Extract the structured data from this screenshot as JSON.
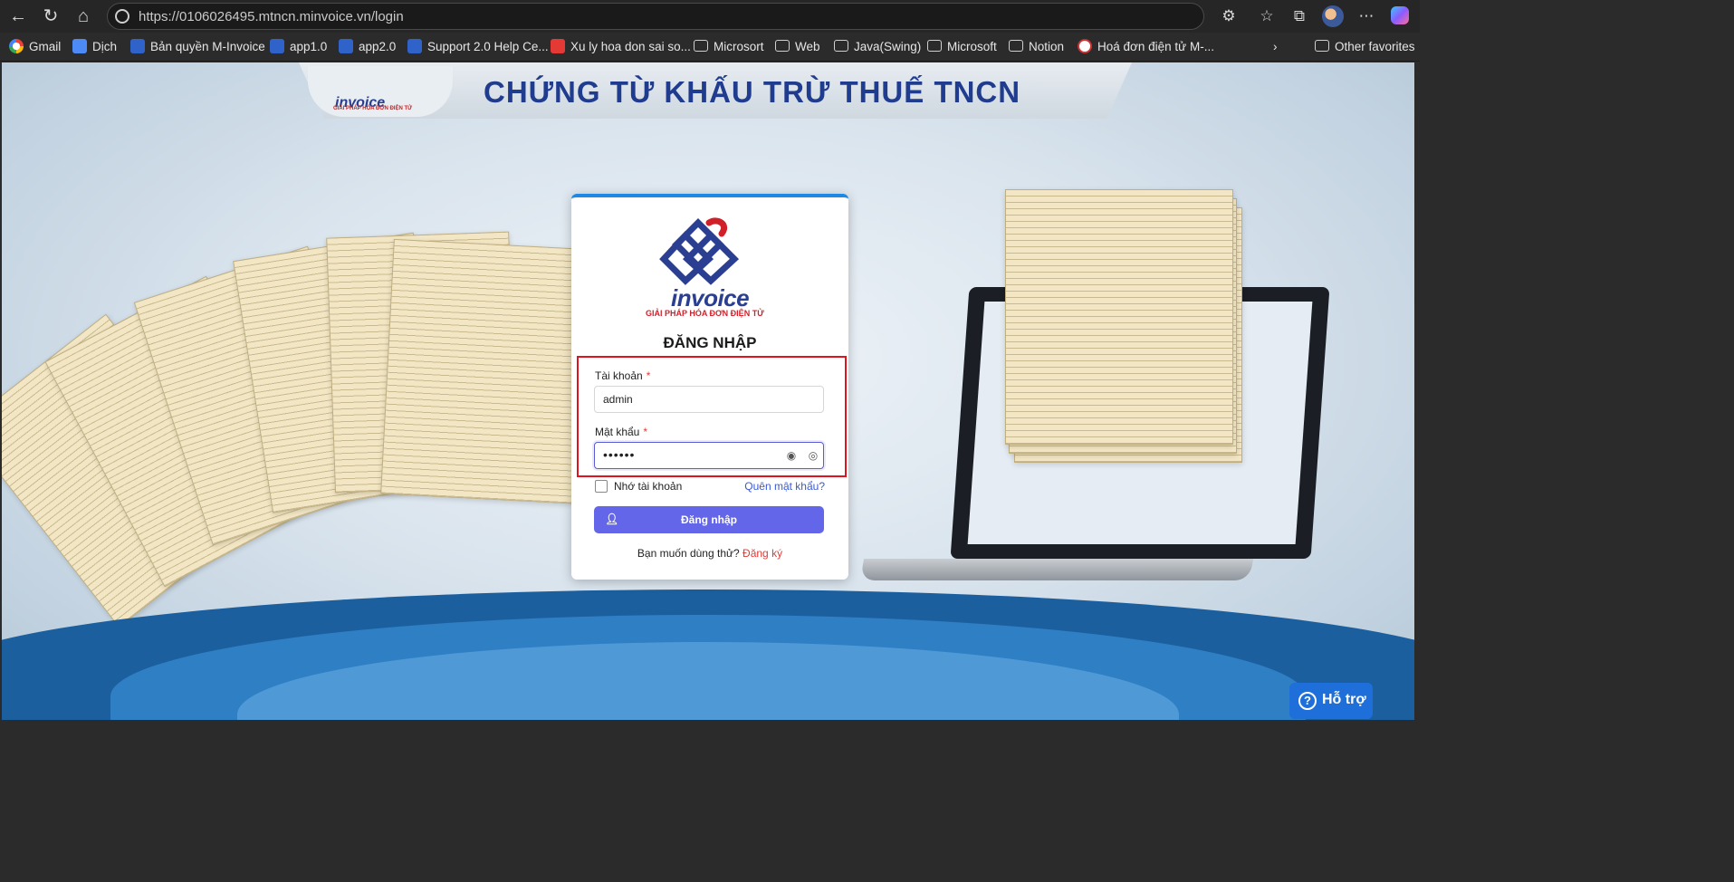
{
  "browser": {
    "url": "https://0106026495.mtncn.minvoice.vn/login",
    "bookmarks": [
      {
        "label": "Gmail",
        "icon": "google-icon"
      },
      {
        "label": "Dịch",
        "icon": "translate-icon"
      },
      {
        "label": "Bản quyền M-Invoice",
        "icon": "minvoice-icon"
      },
      {
        "label": "app1.0",
        "icon": "minvoice-icon"
      },
      {
        "label": "app2.0",
        "icon": "minvoice-icon"
      },
      {
        "label": "Support 2.0 Help Ce...",
        "icon": "minvoice-icon"
      },
      {
        "label": "Xu ly hoa don sai so...",
        "icon": "pdf-icon"
      },
      {
        "label": "Microsort",
        "icon": "folder-icon"
      },
      {
        "label": "Web",
        "icon": "folder-icon"
      },
      {
        "label": "Java(Swing)",
        "icon": "folder-icon"
      },
      {
        "label": "Microsoft",
        "icon": "folder-icon"
      },
      {
        "label": "Notion",
        "icon": "folder-icon"
      },
      {
        "label": "Hoá đơn điện tử M-...",
        "icon": "invoice-icon"
      }
    ],
    "other_favorites": "Other favorites"
  },
  "banner": {
    "title": "CHỨNG TỪ KHẤU TRỪ THUẾ TNCN",
    "logo_text": "invoice",
    "logo_tagline": "GIẢI PHÁP HÓA ĐƠN ĐIỆN TỬ"
  },
  "login": {
    "logo_text": "invoice",
    "logo_tagline": "GIẢI PHÁP HÓA ĐƠN ĐIỆN TỬ",
    "heading": "ĐĂNG NHẬP",
    "account_label": "Tài khoản",
    "account_value": "admin",
    "password_label": "Mật khẩu",
    "password_value": "••••••",
    "required_mark": "*",
    "remember_label": "Nhớ tài khoản",
    "forgot_label": "Quên mật khẩu?",
    "submit_label": "Đăng nhập",
    "trial_prompt": "Bạn muốn dùng thử?",
    "register_label": "Đăng ký"
  },
  "help_button": "Hỗ trợ",
  "colors": {
    "accent": "#6366e8",
    "highlight": "#e0141e",
    "link": "#3a5ad6",
    "required": "#e53935"
  }
}
